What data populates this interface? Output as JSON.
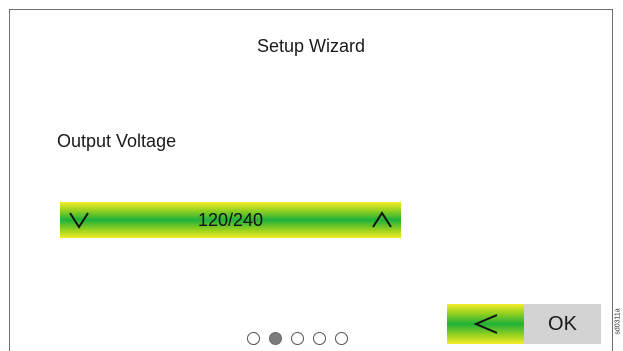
{
  "screen": {
    "title": "Setup Wizard",
    "field_label": "Output Voltage"
  },
  "stepper": {
    "value": "120/240",
    "down_icon": "chevron-down-icon",
    "up_icon": "chevron-up-icon",
    "gradient_colors": [
      "#f4ee2a",
      "#9bd21e",
      "#1fb13a"
    ]
  },
  "pager": {
    "total": 5,
    "current": 2
  },
  "buttons": {
    "back_icon": "chevron-left-icon",
    "ok_label": "OK",
    "ok_color": "#d3d3d3"
  },
  "figure_code": "sd0311a"
}
